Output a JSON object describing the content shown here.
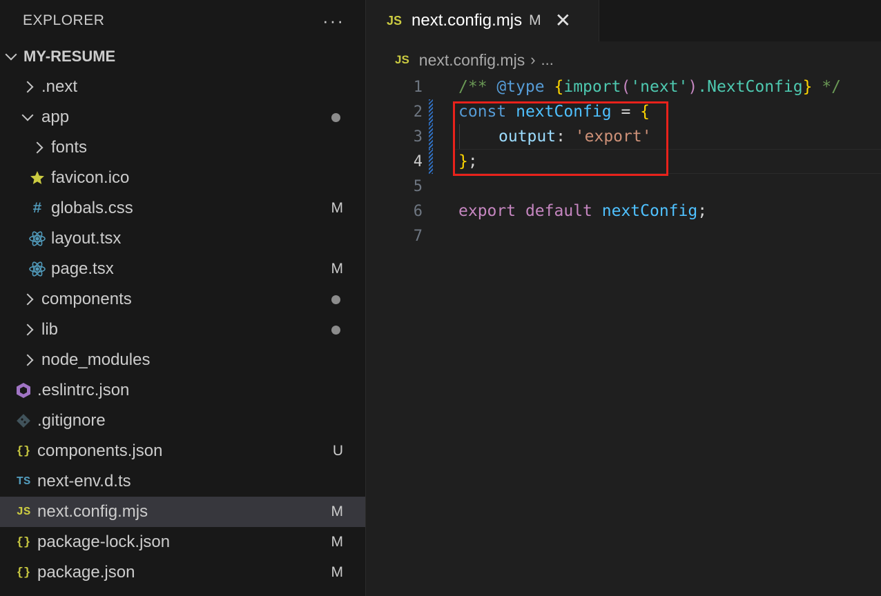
{
  "sidebar": {
    "title": "EXPLORER",
    "more_label": "···",
    "project": "MY-RESUME",
    "items": [
      {
        "label": ".next",
        "kind": "folder",
        "expanded": false,
        "level": 1,
        "badge": "",
        "dot": false
      },
      {
        "label": "app",
        "kind": "folder",
        "expanded": true,
        "level": 1,
        "badge": "",
        "dot": true
      },
      {
        "label": "fonts",
        "kind": "folder",
        "expanded": false,
        "level": 2,
        "badge": "",
        "dot": false
      },
      {
        "label": "favicon.ico",
        "kind": "star",
        "level": 2,
        "badge": "",
        "dot": false
      },
      {
        "label": "globals.css",
        "kind": "css",
        "level": 2,
        "badge": "M",
        "dot": false
      },
      {
        "label": "layout.tsx",
        "kind": "react",
        "level": 2,
        "badge": "",
        "dot": false
      },
      {
        "label": "page.tsx",
        "kind": "react",
        "level": 2,
        "badge": "M",
        "dot": false
      },
      {
        "label": "components",
        "kind": "folder",
        "expanded": false,
        "level": 1,
        "badge": "",
        "dot": true
      },
      {
        "label": "lib",
        "kind": "folder",
        "expanded": false,
        "level": 1,
        "badge": "",
        "dot": true
      },
      {
        "label": "node_modules",
        "kind": "folder",
        "expanded": false,
        "level": 1,
        "badge": "",
        "dot": false
      },
      {
        "label": ".eslintrc.json",
        "kind": "eslint",
        "level": 0,
        "badge": "",
        "dot": false
      },
      {
        "label": ".gitignore",
        "kind": "git",
        "level": 0,
        "badge": "",
        "dot": false
      },
      {
        "label": "components.json",
        "kind": "json",
        "level": 0,
        "badge": "U",
        "dot": false
      },
      {
        "label": "next-env.d.ts",
        "kind": "ts",
        "level": 0,
        "badge": "",
        "dot": false
      },
      {
        "label": "next.config.mjs",
        "kind": "js",
        "level": 0,
        "badge": "M",
        "dot": false,
        "selected": true
      },
      {
        "label": "package-lock.json",
        "kind": "json",
        "level": 0,
        "badge": "M",
        "dot": false
      },
      {
        "label": "package.json",
        "kind": "json",
        "level": 0,
        "badge": "M",
        "dot": false
      }
    ]
  },
  "tab": {
    "icon_text": "JS",
    "name": "next.config.mjs",
    "modified": "M",
    "close": "✕"
  },
  "breadcrumb": {
    "icon_text": "JS",
    "file": "next.config.mjs",
    "sep": "›",
    "ellipsis": "..."
  },
  "code": {
    "line_numbers": [
      "1",
      "2",
      "3",
      "4",
      "5",
      "6",
      "7"
    ],
    "l1": {
      "a": "/** ",
      "b": "@type",
      "c": " ",
      "d": "{",
      "e": "import",
      "f": "(",
      "g": "'next'",
      "h": ")",
      "i": ".NextConfig",
      "j": "}",
      "k": " */"
    },
    "l2": {
      "a": "const",
      "b": " ",
      "c": "nextConfig",
      "d": " = ",
      "e": "{"
    },
    "l3": {
      "a": "output",
      "b": ": ",
      "c": "'export'"
    },
    "l4": {
      "a": "}",
      "b": ";"
    },
    "l6": {
      "a": "export",
      "b": " ",
      "c": "default",
      "d": " ",
      "e": "nextConfig",
      "f": ";"
    }
  },
  "colors": {
    "highlight_box": "#e8221b",
    "js_icon": "#cbcb41",
    "selection": "#37373d"
  }
}
